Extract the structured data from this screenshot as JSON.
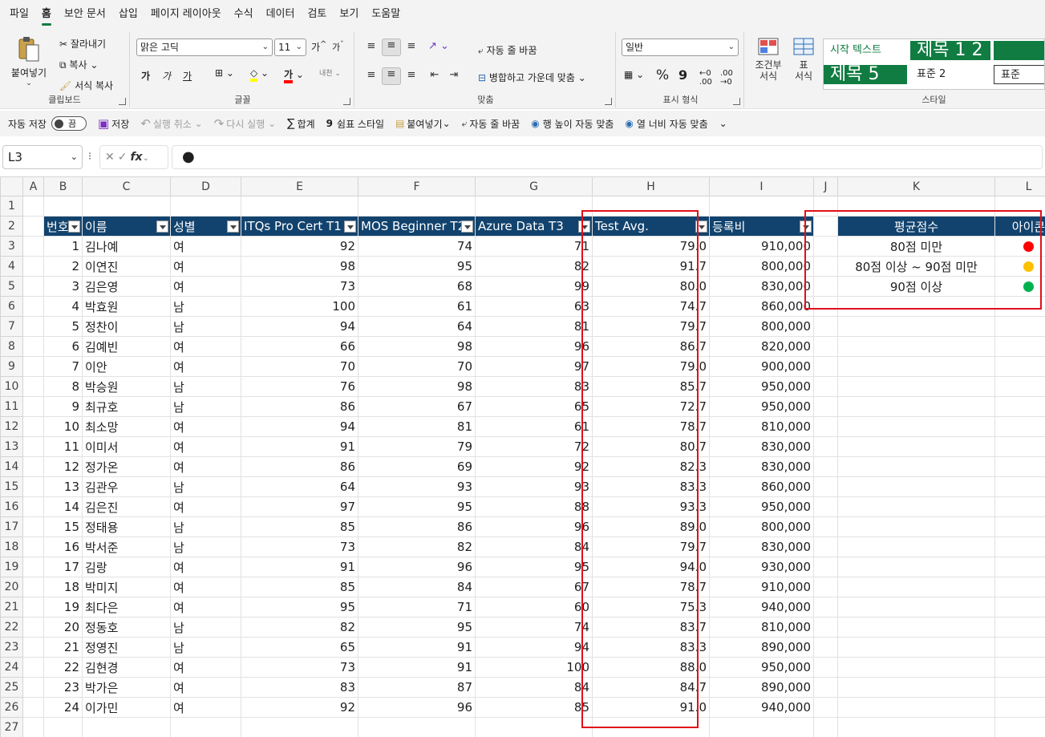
{
  "menu": [
    "파일",
    "홈",
    "보안 문서",
    "삽입",
    "페이지 레이아웃",
    "수식",
    "데이터",
    "검토",
    "보기",
    "도움말"
  ],
  "active_menu": "홈",
  "ribbon": {
    "clipboard": {
      "paste": "붙여넣기",
      "cut": "잘라내기",
      "copy": "복사",
      "format_painter": "서식 복사",
      "label": "클립보드"
    },
    "font": {
      "name": "맑은 고딕",
      "size": "11",
      "label": "글꼴",
      "grow": "가",
      "shrink": "가",
      "bold": "가",
      "italic": "가",
      "underline": "가",
      "font_color": "가"
    },
    "alignment": {
      "wrap": "자동 줄 바꿈",
      "merge": "병합하고 가운데 맞춤",
      "label": "맞춤"
    },
    "number": {
      "format": "일반",
      "percent": "%",
      "comma": "9",
      "label": "표시 형식"
    },
    "styles": {
      "conditional": "조건부\n서식",
      "table": "표\n서식",
      "s1": "시작 텍스트",
      "s2": "제목 1 2",
      "s3": "제목 5",
      "s4": "표준 2",
      "s5": "표준",
      "label": "스타일"
    }
  },
  "qat": {
    "autosave": "자동 저장",
    "autosave_state": "끔",
    "save": "저장",
    "undo": "실행 취소",
    "redo": "다시 실행",
    "sum": "합계",
    "comma_style": "쉼표 스타일",
    "paste": "붙여넣기",
    "wrap": "자동 줄 바꿈",
    "row_fit": "행 높이 자동 맞춤",
    "col_fit": "열 너비 자동 맞춤"
  },
  "formula_bar": {
    "name_box": "L3",
    "content": "●"
  },
  "columns": [
    "A",
    "B",
    "C",
    "D",
    "E",
    "F",
    "G",
    "H",
    "I",
    "J",
    "K",
    "L"
  ],
  "table_headers": [
    "번호",
    "이름",
    "성별",
    "ITQs Pro Cert T1",
    "MOS Beginner T2",
    "Azure Data T3",
    "Test Avg.",
    "등록비"
  ],
  "rows": [
    [
      "1",
      "김나예",
      "여",
      "92",
      "74",
      "71",
      "79.0",
      "910,000"
    ],
    [
      "2",
      "이연진",
      "여",
      "98",
      "95",
      "82",
      "91.7",
      "800,000"
    ],
    [
      "3",
      "김은영",
      "여",
      "73",
      "68",
      "99",
      "80.0",
      "830,000"
    ],
    [
      "4",
      "박효원",
      "남",
      "100",
      "61",
      "63",
      "74.7",
      "860,000"
    ],
    [
      "5",
      "정찬이",
      "남",
      "94",
      "64",
      "81",
      "79.7",
      "800,000"
    ],
    [
      "6",
      "김예빈",
      "여",
      "66",
      "98",
      "96",
      "86.7",
      "820,000"
    ],
    [
      "7",
      "이안",
      "여",
      "70",
      "70",
      "97",
      "79.0",
      "900,000"
    ],
    [
      "8",
      "박승원",
      "남",
      "76",
      "98",
      "83",
      "85.7",
      "950,000"
    ],
    [
      "9",
      "최규호",
      "남",
      "86",
      "67",
      "65",
      "72.7",
      "950,000"
    ],
    [
      "10",
      "최소망",
      "여",
      "94",
      "81",
      "61",
      "78.7",
      "810,000"
    ],
    [
      "11",
      "이미서",
      "여",
      "91",
      "79",
      "72",
      "80.7",
      "830,000"
    ],
    [
      "12",
      "정가온",
      "여",
      "86",
      "69",
      "92",
      "82.3",
      "830,000"
    ],
    [
      "13",
      "김관우",
      "남",
      "64",
      "93",
      "93",
      "83.3",
      "860,000"
    ],
    [
      "14",
      "김은진",
      "여",
      "97",
      "95",
      "88",
      "93.3",
      "950,000"
    ],
    [
      "15",
      "정태용",
      "남",
      "85",
      "86",
      "96",
      "89.0",
      "800,000"
    ],
    [
      "16",
      "박서준",
      "남",
      "73",
      "82",
      "84",
      "79.7",
      "830,000"
    ],
    [
      "17",
      "김랑",
      "여",
      "91",
      "96",
      "95",
      "94.0",
      "930,000"
    ],
    [
      "18",
      "박미지",
      "여",
      "85",
      "84",
      "67",
      "78.7",
      "910,000"
    ],
    [
      "19",
      "최다은",
      "여",
      "95",
      "71",
      "60",
      "75.3",
      "940,000"
    ],
    [
      "20",
      "정동호",
      "남",
      "82",
      "95",
      "74",
      "83.7",
      "810,000"
    ],
    [
      "21",
      "정영진",
      "남",
      "65",
      "91",
      "94",
      "83.3",
      "890,000"
    ],
    [
      "22",
      "김현경",
      "여",
      "73",
      "91",
      "100",
      "88.0",
      "950,000"
    ],
    [
      "23",
      "박가은",
      "여",
      "83",
      "87",
      "84",
      "84.7",
      "890,000"
    ],
    [
      "24",
      "이가민",
      "여",
      "92",
      "96",
      "85",
      "91.0",
      "940,000"
    ]
  ],
  "legend": {
    "headers": [
      "평균점수",
      "아이콘"
    ],
    "items": [
      {
        "label": "80점 미만",
        "color": "#ff0000"
      },
      {
        "label": "80점 이상 ~ 90점 미만",
        "color": "#ffc000"
      },
      {
        "label": "90점 이상",
        "color": "#00b050"
      }
    ]
  },
  "colors": {
    "header_bg": "#12436e",
    "highlight": "#e0101a",
    "excel_green": "#107c41"
  }
}
